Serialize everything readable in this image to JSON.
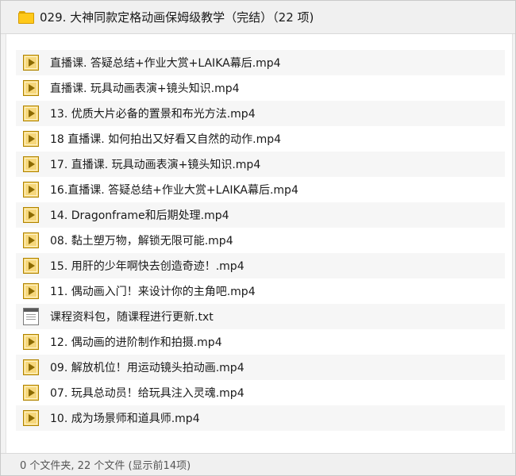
{
  "header": {
    "folder_icon": "folder-icon",
    "title": "029. 大神同款定格动画保姆级教学（完结）（22 项)"
  },
  "files": [
    {
      "name": "直播课. 答疑总结+作业大赏+LAIKA幕后.mp4",
      "icon": "video-file-icon"
    },
    {
      "name": "直播课. 玩具动画表演+镜头知识.mp4",
      "icon": "video-file-icon"
    },
    {
      "name": "13. 优质大片必备的置景和布光方法.mp4",
      "icon": "video-file-icon"
    },
    {
      "name": "18 直播课. 如何拍出又好看又自然的动作.mp4",
      "icon": "video-file-icon"
    },
    {
      "name": "17. 直播课. 玩具动画表演+镜头知识.mp4",
      "icon": "video-file-icon"
    },
    {
      "name": "16.直播课. 答疑总结+作业大赏+LAIKA幕后.mp4",
      "icon": "video-file-icon"
    },
    {
      "name": "14. Dragonframe和后期处理.mp4",
      "icon": "video-file-icon"
    },
    {
      "name": "08. 黏土塑万物，解锁无限可能.mp4",
      "icon": "video-file-icon"
    },
    {
      "name": "15. 用肝的少年啊快去创造奇迹！.mp4",
      "icon": "video-file-icon"
    },
    {
      "name": "11. 偶动画入门！来设计你的主角吧.mp4",
      "icon": "video-file-icon"
    },
    {
      "name": "课程资料包，随课程进行更新.txt",
      "icon": "text-file-icon"
    },
    {
      "name": "12. 偶动画的进阶制作和拍摄.mp4",
      "icon": "video-file-icon"
    },
    {
      "name": "09. 解放机位！用运动镜头拍动画.mp4",
      "icon": "video-file-icon"
    },
    {
      "name": "07. 玩具总动员！给玩具注入灵魂.mp4",
      "icon": "video-file-icon"
    },
    {
      "name": "10. 成为场景师和道具师.mp4",
      "icon": "video-file-icon"
    }
  ],
  "footer": {
    "status": "0 个文件夹, 22 个文件 (显示前14项)"
  }
}
